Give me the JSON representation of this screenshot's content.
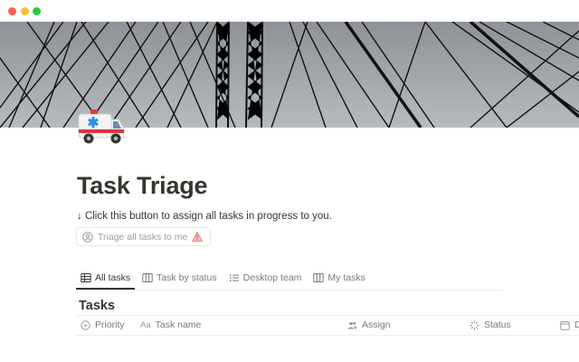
{
  "page": {
    "title": "Task Triage",
    "icon": "ambulance-emoji",
    "instruction": "↓ Click this button to assign all tasks in progress to you."
  },
  "triage_button": {
    "label": "Triage all tasks to me",
    "icon_left": "user-circle-icon",
    "icon_right": "warning-icon"
  },
  "tabs": [
    {
      "label": "All tasks",
      "icon": "table-icon",
      "active": true
    },
    {
      "label": "Task by status",
      "icon": "board-icon",
      "active": false
    },
    {
      "label": "Desktop team",
      "icon": "list-icon",
      "active": false
    },
    {
      "label": "My tasks",
      "icon": "board-icon",
      "active": false
    }
  ],
  "database": {
    "title": "Tasks",
    "columns": [
      {
        "label": "Priority",
        "icon": "select-icon"
      },
      {
        "label": "Task name",
        "icon": "text-aa-icon"
      },
      {
        "label": "Assign",
        "icon": "people-icon"
      },
      {
        "label": "Status",
        "icon": "status-icon"
      },
      {
        "label": "D",
        "icon": "calendar-icon"
      }
    ]
  },
  "colors": {
    "text": "#37352f",
    "muted": "#787774",
    "border": "#e9e9e7",
    "cover_sky": "#9fa3a8"
  }
}
